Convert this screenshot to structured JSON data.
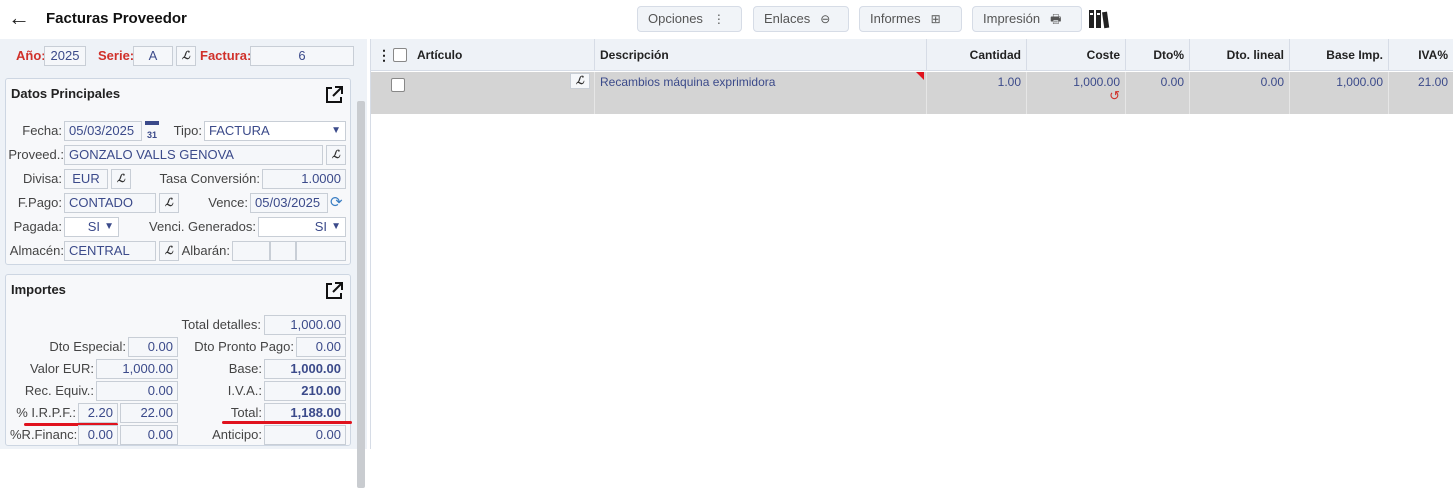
{
  "header": {
    "title": "Facturas Proveedor",
    "buttons": [
      {
        "label": "Opciones",
        "icon": "⋮"
      },
      {
        "label": "Enlaces",
        "icon": "⊖"
      },
      {
        "label": "Informes",
        "icon": "⊞"
      },
      {
        "label": "Impresión",
        "icon": "🖶"
      }
    ]
  },
  "doc": {
    "year_label": "Año:",
    "year": "2025",
    "serie_label": "Serie:",
    "serie": "A",
    "factura_label": "Factura:",
    "factura": "6"
  },
  "datos": {
    "title": "Datos Principales",
    "fecha_label": "Fecha:",
    "fecha": "05/03/2025",
    "tipo_label": "Tipo:",
    "tipo": "FACTURA",
    "proveed_label": "Proveed.:",
    "proveed": "GONZALO VALLS GENOVA",
    "divisa_label": "Divisa:",
    "divisa": "EUR",
    "tasa_label": "Tasa Conversión:",
    "tasa": "1.0000",
    "fpago_label": "F.Pago:",
    "fpago": "CONTADO",
    "vence_label": "Vence:",
    "vence": "05/03/2025",
    "pagada_label": "Pagada:",
    "pagada": "SI",
    "venci_label": "Venci. Generados:",
    "venci": "SI",
    "almacen_label": "Almacén:",
    "almacen": "CENTRAL",
    "albaran_label": "Albarán:"
  },
  "importes": {
    "title": "Importes",
    "total_detalles_label": "Total detalles:",
    "total_detalles": "1,000.00",
    "dto_especial_label": "Dto Especial:",
    "dto_especial": "0.00",
    "dto_pronto_label": "Dto Pronto Pago:",
    "dto_pronto": "0.00",
    "valor_eur_label": "Valor EUR:",
    "valor_eur": "1,000.00",
    "base_label": "Base:",
    "base": "1,000.00",
    "rec_equiv_label": "Rec. Equiv.:",
    "rec_equiv": "0.00",
    "iva_label": "I.V.A.:",
    "iva": "210.00",
    "irpf_label": "% I.R.P.F.:",
    "irpf_pct": "2.20",
    "irpf_val": "22.00",
    "total_label": "Total:",
    "total": "1,188.00",
    "rfinanc_label": "%R.Financ:",
    "rfinanc_pct": "0.00",
    "rfinanc_val": "0.00",
    "anticipo_label": "Anticipo:",
    "anticipo": "0.00"
  },
  "table": {
    "columns": [
      "Artículo",
      "Descripción",
      "Cantidad",
      "Coste",
      "Dto%",
      "Dto. lineal",
      "Base Imp.",
      "IVA%"
    ],
    "rows": [
      {
        "articulo": "",
        "descripcion": "Recambios máquina exprimidora",
        "cantidad": "1.00",
        "coste": "1,000.00",
        "dto": "0.00",
        "dto_lineal": "0.00",
        "base_imp": "1,000.00",
        "iva": "21.00"
      }
    ]
  },
  "colors": {
    "accent_red": "#d0302a",
    "value_blue": "#3b4a8a",
    "annotation_red": "#e0121d"
  }
}
